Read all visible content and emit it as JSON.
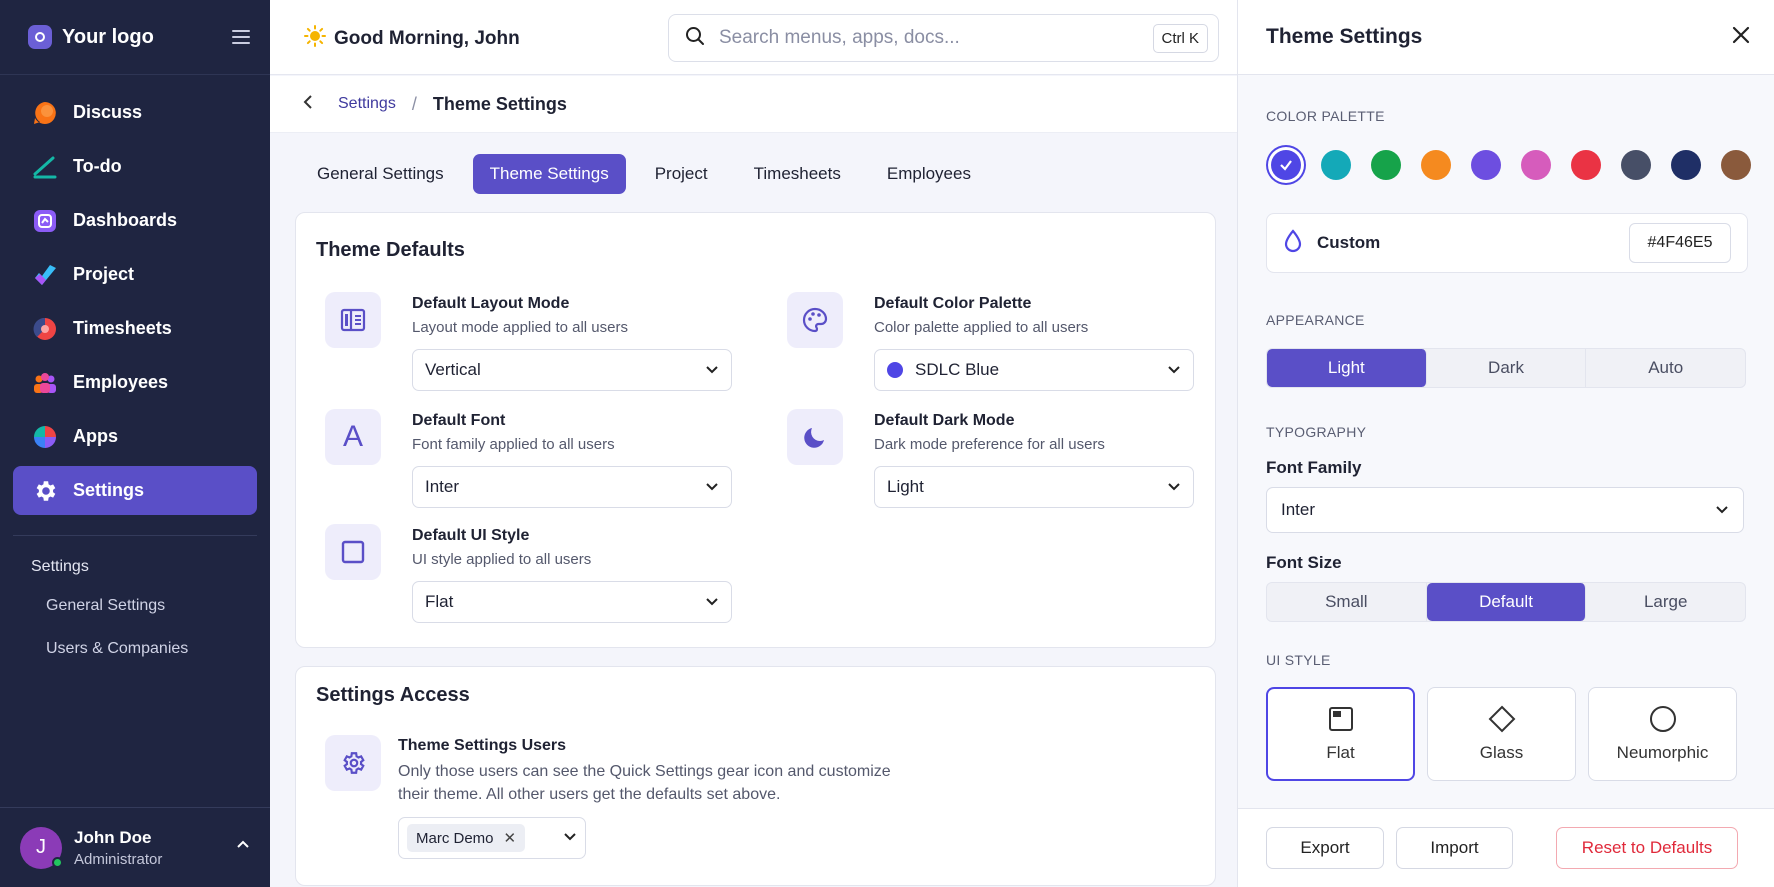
{
  "sidebar": {
    "logo_text": "Your logo",
    "items": [
      {
        "label": "Discuss",
        "icon": "discuss-icon"
      },
      {
        "label": "To-do",
        "icon": "todo-icon"
      },
      {
        "label": "Dashboards",
        "icon": "dashboard-icon"
      },
      {
        "label": "Project",
        "icon": "project-icon"
      },
      {
        "label": "Timesheets",
        "icon": "timesheet-icon"
      },
      {
        "label": "Employees",
        "icon": "employees-icon"
      },
      {
        "label": "Apps",
        "icon": "apps-icon"
      },
      {
        "label": "Settings",
        "icon": "gear-icon",
        "active": true
      }
    ],
    "sub_title": "Settings",
    "sub_items": [
      "General Settings",
      "Users & Companies"
    ],
    "user": {
      "initial": "J",
      "name": "John Doe",
      "role": "Administrator"
    }
  },
  "header": {
    "greeting": "Good Morning, John",
    "search_placeholder": "Search menus, apps, docs...",
    "shortcut": "Ctrl K"
  },
  "breadcrumb": {
    "parent": "Settings",
    "separator": "/",
    "current": "Theme Settings"
  },
  "tabs": [
    {
      "label": "General Settings"
    },
    {
      "label": "Theme Settings",
      "active": true
    },
    {
      "label": "Project"
    },
    {
      "label": "Timesheets"
    },
    {
      "label": "Employees"
    }
  ],
  "theme_defaults": {
    "title": "Theme Defaults",
    "layout": {
      "label": "Default Layout Mode",
      "desc": "Layout mode applied to all users",
      "value": "Vertical"
    },
    "palette": {
      "label": "Default Color Palette",
      "desc": "Color palette applied to all users",
      "value": "SDLC Blue"
    },
    "font": {
      "label": "Default Font",
      "desc": "Font family applied to all users",
      "value": "Inter",
      "icon_glyph": "A"
    },
    "dark": {
      "label": "Default Dark Mode",
      "desc": "Dark mode preference for all users",
      "value": "Light"
    },
    "ui_style": {
      "label": "Default UI Style",
      "desc": "UI style applied to all users",
      "value": "Flat"
    }
  },
  "settings_access": {
    "title": "Settings Access",
    "label": "Theme Settings Users",
    "desc": "Only those users can see the Quick Settings gear icon and customize their theme. All other users get the defaults set above.",
    "chip": "Marc Demo"
  },
  "panel": {
    "title": "Theme Settings",
    "color_palette_title": "COLOR PALETTE",
    "swatches": [
      "#4f46e5",
      "#14a9b8",
      "#16a34a",
      "#f58a1f",
      "#6d4ee0",
      "#d65cbc",
      "#ea3344",
      "#474f67",
      "#1f2f66",
      "#8a5a3c"
    ],
    "custom_label": "Custom",
    "custom_hex": "#4F46E5",
    "appearance_title": "APPEARANCE",
    "appearance": [
      "Light",
      "Dark",
      "Auto"
    ],
    "typography_title": "TYPOGRAPHY",
    "font_family_label": "Font Family",
    "font_family_value": "Inter",
    "font_size_label": "Font Size",
    "font_sizes": [
      "Small",
      "Default",
      "Large"
    ],
    "ui_style_title": "UI STYLE",
    "ui_styles": [
      "Flat",
      "Glass",
      "Neumorphic"
    ],
    "export_label": "Export",
    "import_label": "Import",
    "reset_label": "Reset to Defaults"
  },
  "colors": {
    "accent": "#5a4fc7",
    "sidebar_bg": "#1f2541",
    "danger": "#e0293a"
  }
}
